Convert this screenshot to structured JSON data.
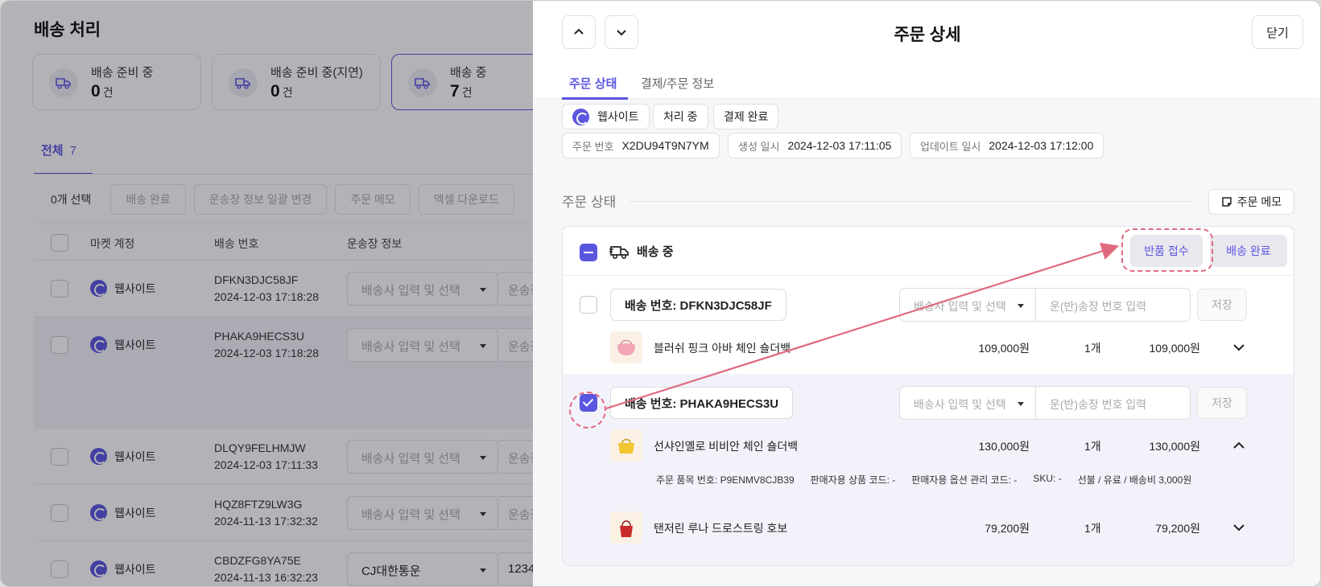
{
  "page": {
    "title": "배송 처리",
    "stats": [
      {
        "label": "배송 준비 중",
        "value": "0",
        "unit": "건"
      },
      {
        "label": "배송 준비 중(지연)",
        "value": "0",
        "unit": "건"
      },
      {
        "label": "배송 중",
        "value": "7",
        "unit": "건"
      }
    ],
    "tab": {
      "label": "전체",
      "count": "7"
    },
    "toolbar": {
      "selected": "0개 선택",
      "buttons": [
        "배송 완료",
        "운송장 정보 일괄 변경",
        "주문 메모",
        "엑셀 다운로드"
      ]
    },
    "columns": [
      "마켓 계정",
      "배송 번호",
      "운송장 정보"
    ],
    "rows": [
      {
        "market": "웹사이트",
        "no": "DFKN3DJC58JF",
        "date": "2024-12-03 17:18:28",
        "courier": "배송사 입력 및 선택",
        "invoice": "운송장"
      },
      {
        "market": "웹사이트",
        "no": "PHAKA9HECS3U",
        "date": "2024-12-03 17:18:28",
        "courier": "배송사 입력 및 선택",
        "invoice": "운송장"
      },
      {
        "market": "웹사이트",
        "no": "DLQY9FELHMJW",
        "date": "2024-12-03 17:11:33",
        "courier": "배송사 입력 및 선택",
        "invoice": "운송장"
      },
      {
        "market": "웹사이트",
        "no": "HQZ8FTZ9LW3G",
        "date": "2024-11-13 17:32:32",
        "courier": "배송사 입력 및 선택",
        "invoice": "운송장"
      },
      {
        "market": "웹사이트",
        "no": "CBDZFG8YA75E",
        "date": "2024-11-13 16:32:23",
        "courier": "CJ대한통운",
        "invoice": "1234"
      }
    ]
  },
  "drawer": {
    "title": "주문 상세",
    "close": "닫기",
    "tabs": [
      "주문 상태",
      "결제/주문 정보"
    ],
    "chips": {
      "market": "웹사이트",
      "status": "처리 중",
      "payment": "결제 완료"
    },
    "info": [
      {
        "key": "주문 번호",
        "value": "X2DU94T9N7YM"
      },
      {
        "key": "생성 일시",
        "value": "2024-12-03 17:11:05"
      },
      {
        "key": "업데이트 일시",
        "value": "2024-12-03 17:12:00"
      }
    ],
    "section_title": "주문 상태",
    "memo_button": "주문 메모",
    "status_label": "배송 중",
    "return_button": "반품 접수",
    "done_button": "배송 완료",
    "courier_placeholder": "배송사 입력 및 선택",
    "tracking_placeholder": "운(반)송장 번호 입력",
    "save": "저장",
    "shipments": [
      {
        "label": "배송 번호: DFKN3DJC58JF",
        "checked": false,
        "items": [
          {
            "name": "블러쉬 핑크 아바 체인 숄더백",
            "price": "109,000원",
            "qty": "1개",
            "total": "109,000원"
          }
        ]
      },
      {
        "label": "배송 번호: PHAKA9HECS3U",
        "checked": true,
        "items": [
          {
            "name": "선샤인옐로 비비안 체인 숄더백",
            "price": "130,000원",
            "qty": "1개",
            "total": "130,000원"
          },
          {
            "name": "탠저린 루나 드로스트링 호보",
            "price": "79,200원",
            "qty": "1개",
            "total": "79,200원"
          }
        ],
        "meta": [
          "주문 품목 번호: P9ENMV8CJB39",
          "판매자용 상품 코드: -",
          "판매자용 옵션 관리 코드: -",
          "SKU: -",
          "선불 / 유료 / 배송비 3,000원"
        ]
      }
    ]
  },
  "colors": {
    "accent": "#5b56e0",
    "annotation": "#e06a7f"
  },
  "icons": [
    "truck-icon",
    "chevron-up-icon",
    "chevron-down-icon",
    "memo-icon",
    "website-logo-icon"
  ]
}
